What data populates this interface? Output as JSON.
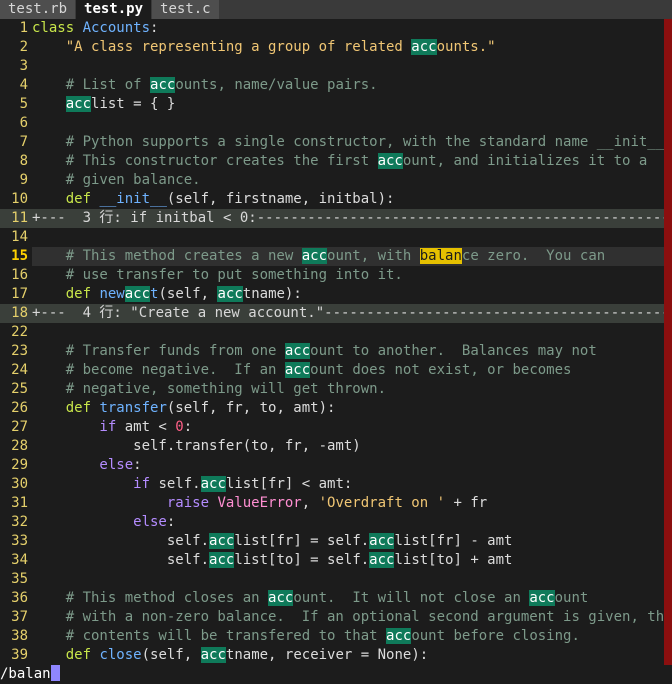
{
  "tabs": [
    "test.rb",
    "test.py",
    "test.c"
  ],
  "active_tab": 1,
  "lines": [
    {
      "n": "1",
      "segs": [
        [
          "kw",
          "class "
        ],
        [
          "fn",
          "Accounts"
        ],
        [
          "",
          ""
        ],
        [
          "",
          ":"
        ]
      ]
    },
    {
      "n": "2",
      "segs": [
        [
          "str",
          "    \"A class representing a group of related "
        ],
        [
          "hl",
          "acc"
        ],
        [
          "str",
          "ounts.\""
        ]
      ]
    },
    {
      "n": "3",
      "segs": []
    },
    {
      "n": "4",
      "segs": [
        [
          "com",
          "    # List of "
        ],
        [
          "hl",
          "acc"
        ],
        [
          "com",
          "ounts, name/value pairs."
        ]
      ]
    },
    {
      "n": "5",
      "segs": [
        [
          "",
          "    "
        ],
        [
          "hl",
          "acc"
        ],
        [
          "",
          "list = { }"
        ]
      ]
    },
    {
      "n": "6",
      "segs": []
    },
    {
      "n": "7",
      "segs": [
        [
          "com",
          "    # Python supports a single constructor, with the standard name __init__."
        ]
      ]
    },
    {
      "n": "8",
      "segs": [
        [
          "com",
          "    # This constructor creates the first "
        ],
        [
          "hl",
          "acc"
        ],
        [
          "com",
          "ount, and initializes it to a"
        ]
      ]
    },
    {
      "n": "9",
      "segs": [
        [
          "com",
          "    # given balance."
        ]
      ]
    },
    {
      "n": "10",
      "segs": [
        [
          "kw",
          "    def "
        ],
        [
          "fn",
          "__init__"
        ],
        [
          "",
          "(self, firstname, initbal):"
        ]
      ]
    },
    {
      "n": "11",
      "fold": true,
      "segs": [
        [
          "",
          "+---  3 行: if initbal < 0:--------------------------------------------------------------"
        ]
      ]
    },
    {
      "n": "14",
      "segs": []
    },
    {
      "n": "15",
      "cursor": true,
      "segs": [
        [
          "com",
          "    # This method creates a new "
        ],
        [
          "hl",
          "acc"
        ],
        [
          "com",
          "ount, with "
        ],
        [
          "hl-cur",
          "balan"
        ],
        [
          "com",
          "ce zero.  You can"
        ]
      ]
    },
    {
      "n": "16",
      "segs": [
        [
          "com",
          "    # use transfer to put something into it."
        ]
      ]
    },
    {
      "n": "17",
      "segs": [
        [
          "kw",
          "    def "
        ],
        [
          "fn",
          "new"
        ],
        [
          "hl",
          "acc"
        ],
        [
          "fn",
          "t"
        ],
        [
          "",
          "(self, "
        ],
        [
          "hl",
          "acc"
        ],
        [
          "",
          "tname):"
        ]
      ]
    },
    {
      "n": "18",
      "fold": true,
      "segs": [
        [
          "",
          "+---  4 行: \"Create a new account.\"---------------------------------------------------"
        ]
      ]
    },
    {
      "n": "22",
      "segs": []
    },
    {
      "n": "23",
      "segs": [
        [
          "com",
          "    # Transfer funds from one "
        ],
        [
          "hl",
          "acc"
        ],
        [
          "com",
          "ount to another.  Balances may not"
        ]
      ]
    },
    {
      "n": "24",
      "segs": [
        [
          "com",
          "    # become negative.  If an "
        ],
        [
          "hl",
          "acc"
        ],
        [
          "com",
          "ount does not exist, or becomes"
        ]
      ]
    },
    {
      "n": "25",
      "segs": [
        [
          "com",
          "    # negative, something will get thrown."
        ]
      ]
    },
    {
      "n": "26",
      "segs": [
        [
          "kw",
          "    def "
        ],
        [
          "fn",
          "transfer"
        ],
        [
          "",
          "(self, fr, to, amt):"
        ]
      ]
    },
    {
      "n": "27",
      "segs": [
        [
          "ctrl",
          "        if "
        ],
        [
          "",
          "amt < "
        ],
        [
          "num",
          "0"
        ],
        [
          "",
          ":"
        ]
      ]
    },
    {
      "n": "28",
      "segs": [
        [
          "",
          "            self.transfer(to, fr, -amt)"
        ]
      ]
    },
    {
      "n": "29",
      "segs": [
        [
          "ctrl",
          "        else"
        ],
        [
          "",
          ":"
        ]
      ]
    },
    {
      "n": "30",
      "segs": [
        [
          "ctrl",
          "            if "
        ],
        [
          "",
          "self."
        ],
        [
          "hl",
          "acc"
        ],
        [
          "",
          "list[fr] < amt:"
        ]
      ]
    },
    {
      "n": "31",
      "segs": [
        [
          "ctrl",
          "                raise "
        ],
        [
          "exc",
          "ValueError"
        ],
        [
          "",
          ", "
        ],
        [
          "str",
          "'Overdraft on '"
        ],
        [
          "",
          " + fr"
        ]
      ]
    },
    {
      "n": "32",
      "segs": [
        [
          "ctrl",
          "            else"
        ],
        [
          "",
          ":"
        ]
      ]
    },
    {
      "n": "33",
      "segs": [
        [
          "",
          "                self."
        ],
        [
          "hl",
          "acc"
        ],
        [
          "",
          "list[fr] = self."
        ],
        [
          "hl",
          "acc"
        ],
        [
          "",
          "list[fr] - amt"
        ]
      ]
    },
    {
      "n": "34",
      "segs": [
        [
          "",
          "                self."
        ],
        [
          "hl",
          "acc"
        ],
        [
          "",
          "list[to] = self."
        ],
        [
          "hl",
          "acc"
        ],
        [
          "",
          "list[to] + amt"
        ]
      ]
    },
    {
      "n": "35",
      "segs": []
    },
    {
      "n": "36",
      "segs": [
        [
          "com",
          "    # This method closes an "
        ],
        [
          "hl",
          "acc"
        ],
        [
          "com",
          "ount.  It will not close an "
        ],
        [
          "hl",
          "acc"
        ],
        [
          "com",
          "ount"
        ]
      ]
    },
    {
      "n": "37",
      "segs": [
        [
          "com",
          "    # with a non-zero balance.  If an optional second argument is given, the"
        ]
      ]
    },
    {
      "n": "38",
      "segs": [
        [
          "com",
          "    # contents will be transfered to that "
        ],
        [
          "hl",
          "acc"
        ],
        [
          "com",
          "ount before closing."
        ]
      ]
    },
    {
      "n": "39",
      "segs": [
        [
          "kw",
          "    def "
        ],
        [
          "fn",
          "close"
        ],
        [
          "",
          "(self, "
        ],
        [
          "hl",
          "acc"
        ],
        [
          "",
          "tname, receiver = None):"
        ]
      ]
    }
  ],
  "command_line": "/balan",
  "colors": {
    "background": "#1c1c1c",
    "search_match": "#0f7a5a",
    "current_match": "#e5c000",
    "scrollbar": "#8b0f0f"
  }
}
